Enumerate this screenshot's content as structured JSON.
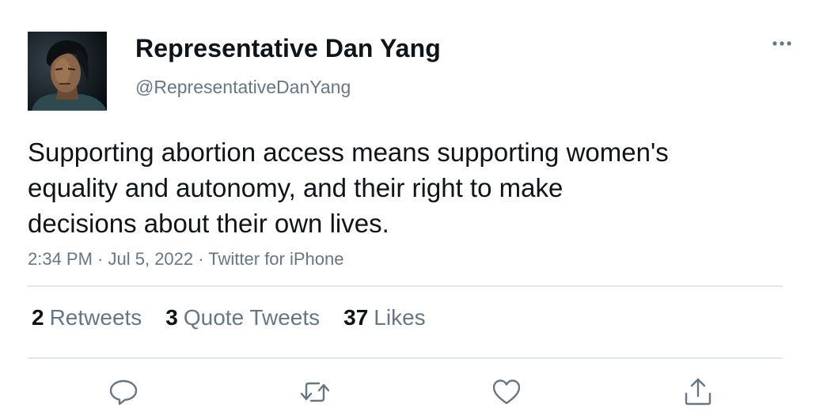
{
  "user": {
    "display_name": "Representative Dan Yang",
    "handle": "@RepresentativeDanYang",
    "avatar_icon": "portrait-photo"
  },
  "tweet": {
    "text": "Supporting abortion access means supporting women's\nequality and autonomy, and their right to make\ndecisions about their own lives.",
    "time": "2:34 PM",
    "separator": " · ",
    "date": "Jul 5, 2022",
    "client": "Twitter for iPhone"
  },
  "stats": [
    {
      "count": "2",
      "label": "Retweets"
    },
    {
      "count": "3",
      "label": "Quote Tweets"
    },
    {
      "count": "37",
      "label": "Likes"
    }
  ],
  "actions": [
    {
      "icon": "reply-icon"
    },
    {
      "icon": "retweet-icon"
    },
    {
      "icon": "like-icon"
    },
    {
      "icon": "share-icon"
    }
  ],
  "more_icon": "more-options-icon",
  "colors": {
    "text": "#0f1419",
    "secondary": "#657786",
    "divider": "#e1e8ed"
  }
}
